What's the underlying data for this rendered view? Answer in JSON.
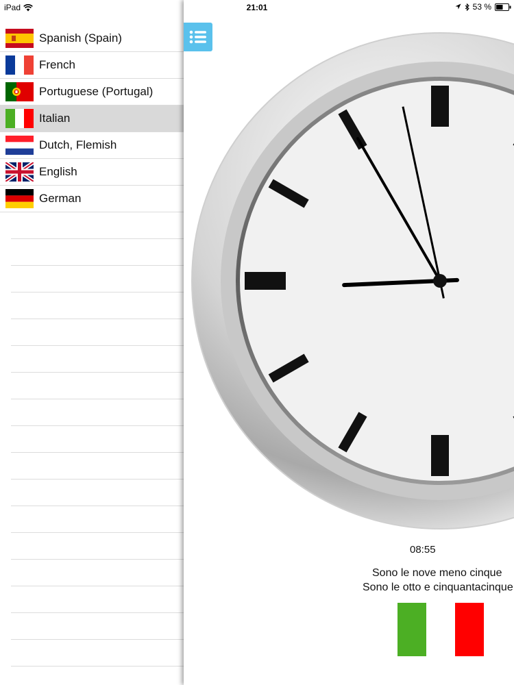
{
  "status": {
    "device": "iPad",
    "time": "21:01",
    "battery": "53 %"
  },
  "sidebar": {
    "items": [
      {
        "label": "Spanish (Spain)",
        "flag": "spain-flag-icon",
        "selected": false
      },
      {
        "label": "French",
        "flag": "france-flag-icon",
        "selected": false
      },
      {
        "label": "Portuguese (Portugal)",
        "flag": "portugal-flag-icon",
        "selected": false
      },
      {
        "label": "Italian",
        "flag": "italy-flag-icon",
        "selected": true
      },
      {
        "label": "Dutch, Flemish",
        "flag": "netherlands-flag-icon",
        "selected": false
      },
      {
        "label": "English",
        "flag": "uk-flag-icon",
        "selected": false
      },
      {
        "label": "German",
        "flag": "germany-flag-icon",
        "selected": false
      }
    ]
  },
  "main": {
    "menu_icon": "list-icon",
    "clock": {
      "hours": 8,
      "minutes": 55,
      "seconds": 58
    },
    "digital_time": "08:55",
    "sentences": [
      "Sono le nove meno cinque",
      "Sono le otto e cinquantacinque"
    ],
    "flag": "italy-flag-icon"
  },
  "colors": {
    "accent": "#5ac1ec",
    "selected_row": "#d9d9d9",
    "italy_green": "#4caf24",
    "italy_red": "#ff0000"
  }
}
